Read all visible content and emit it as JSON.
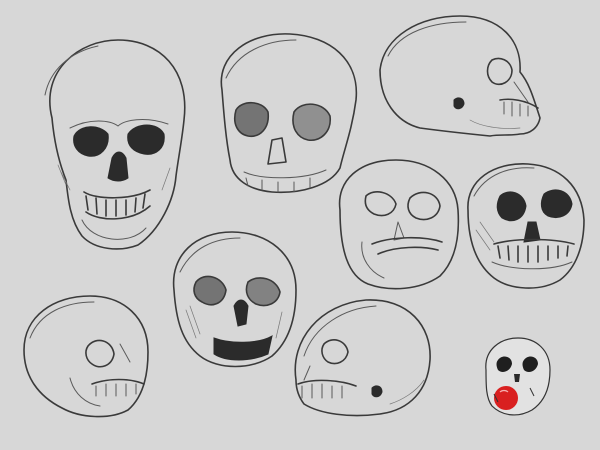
{
  "scene": {
    "background": "#d7d7d7",
    "ink": "#3a3a3a",
    "bone_tone": "#e2e2e2",
    "accent": "#d92020",
    "subject": "skull-sketches"
  }
}
